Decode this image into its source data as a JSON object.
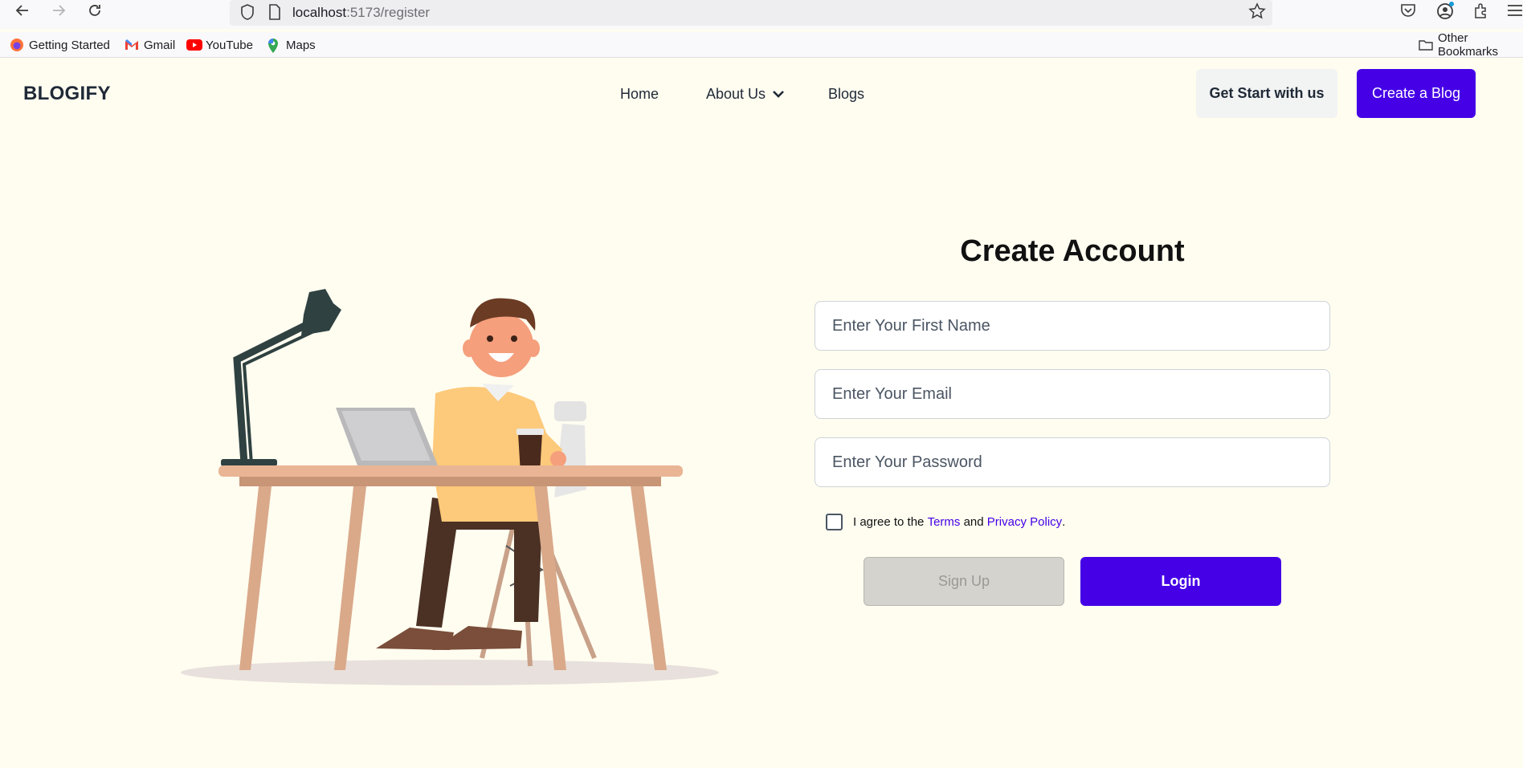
{
  "browser": {
    "url_host": "localhost",
    "url_path": ":5173/register",
    "bookmarks": [
      {
        "label": "Getting Started",
        "icon": "firefox-icon"
      },
      {
        "label": "Gmail",
        "icon": "gmail-icon"
      },
      {
        "label": "YouTube",
        "icon": "youtube-icon"
      },
      {
        "label": "Maps",
        "icon": "maps-icon"
      }
    ],
    "other_bookmarks": "Other Bookmarks"
  },
  "header": {
    "brand": "BLOGIFY",
    "nav": [
      {
        "label": "Home"
      },
      {
        "label": "About Us"
      },
      {
        "label": "Blogs"
      }
    ],
    "get_start_label": "Get Start with us",
    "create_blog_label": "Create a Blog"
  },
  "form": {
    "title": "Create Account",
    "first_name_placeholder": "Enter Your First Name",
    "email_placeholder": "Enter Your Email",
    "password_placeholder": "Enter Your Password",
    "agree_prefix": "I agree to the ",
    "terms_label": "Terms",
    "agree_and": " and ",
    "privacy_label": "Privacy Policy",
    "agree_suffix": ".",
    "signup_label": "Sign Up",
    "login_label": "Login"
  },
  "colors": {
    "page_bg": "#fffdf0",
    "accent": "#4500e6",
    "signup_disabled": "#d4d3ce"
  }
}
